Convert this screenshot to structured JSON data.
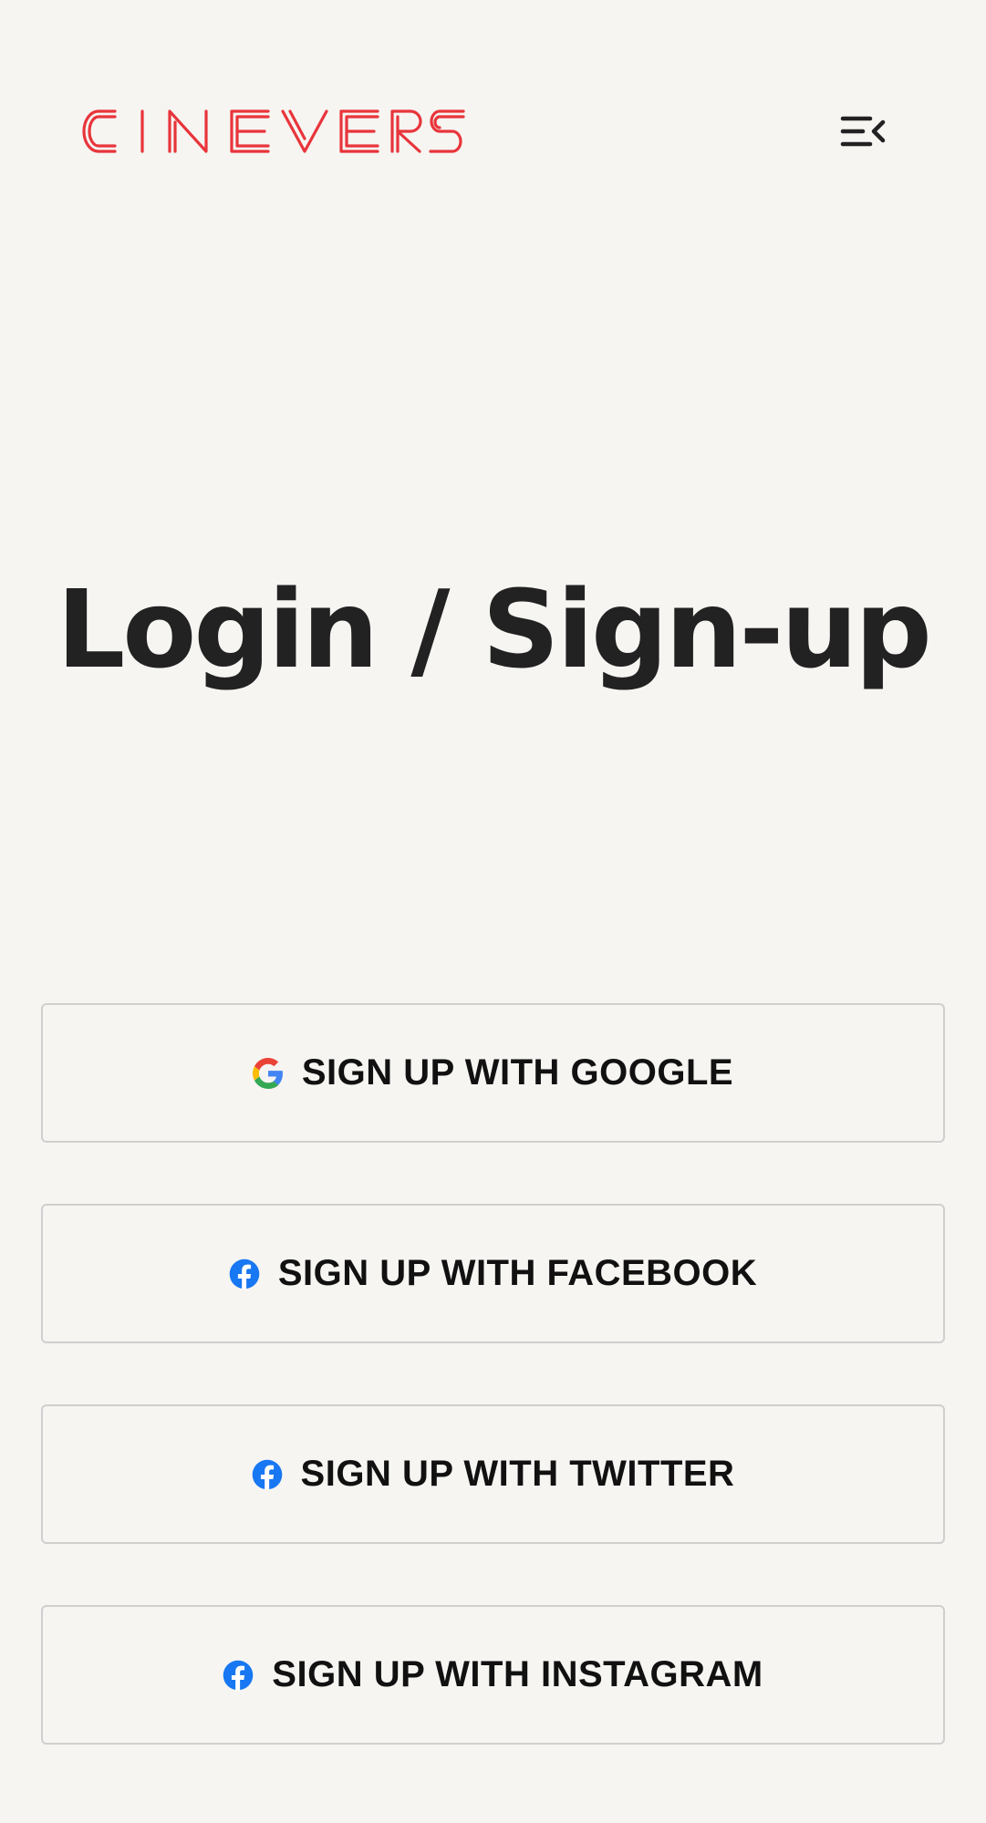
{
  "header": {
    "logo_text": "CINEVERSE",
    "logo_color": "#e8353b",
    "menu_icon": "menu-collapse-icon"
  },
  "main": {
    "title": "Login / Sign-up"
  },
  "auth_buttons": [
    {
      "label": "SIGN UP WITH GOOGLE",
      "icon": "google-icon"
    },
    {
      "label": "SIGN UP WITH FACEBOOK",
      "icon": "facebook-icon"
    },
    {
      "label": "SIGN UP WITH TWITTER",
      "icon": "facebook-icon"
    },
    {
      "label": "SIGN UP WITH INSTAGRAM",
      "icon": "facebook-icon"
    }
  ],
  "colors": {
    "background": "#f6f5f2",
    "button_border": "#cfcfcf",
    "facebook_blue": "#1877f2"
  }
}
